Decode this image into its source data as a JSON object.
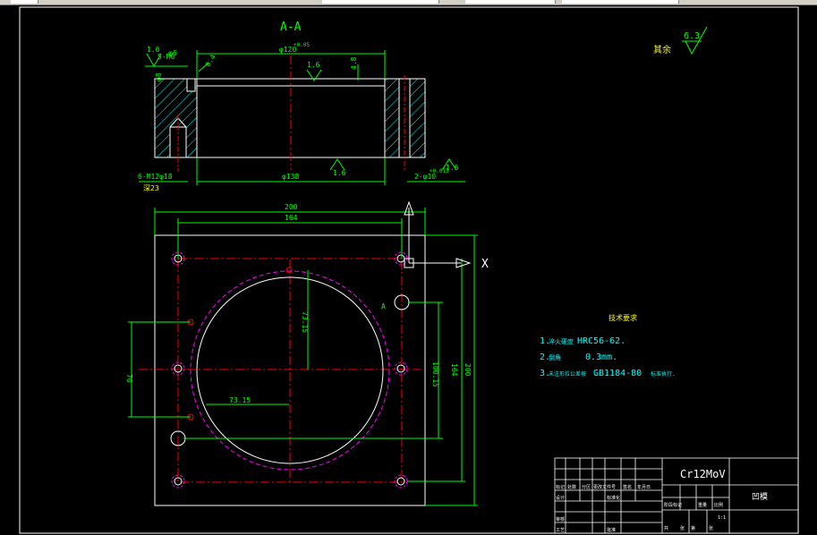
{
  "section_title": "A-A",
  "dimensions": {
    "d_top_a": "1.6",
    "d_top_b": "5-M6",
    "d_top_c": "φ6",
    "d_top_d": "φ8",
    "d_mid_top": "φ120",
    "d_mid_tol": "+0.05",
    "d_angle": "0.4",
    "d_rough_mid": "1.6",
    "d_depth": "4.8",
    "d_bot_left": "6-M12φ18",
    "d_bot_left2": "深23",
    "d_bot_center": "φ138",
    "d_rough_bot": "1.6",
    "d_bot_right": "2-φ10",
    "d_bot_right_tol": "+0.015",
    "d_rough_right": "1.6",
    "w_200": "200",
    "w_164": "164",
    "h_7315_a": "73.15",
    "h_7315_b": "73.15",
    "h_70": "70",
    "h_10015": "100.15",
    "h_164": "164",
    "h_200": "200",
    "label_a": "A",
    "label_a2": "A",
    "axis_x": "X"
  },
  "surface_finish": {
    "label": "其余",
    "value": "6.3"
  },
  "tech_requirements": {
    "title": "技术要求",
    "line1_prefix": "1.",
    "line1_cn": "淬火硬度",
    "line1_val": "HRC56-62.",
    "line2_prefix": "2.",
    "line2_cn": "倒角",
    "line2_val": "0.3mm.",
    "line3_prefix": "3.",
    "line3_cn": "未注形位公差按",
    "line3_val": "GB1184-80",
    "line3_suffix": "标准执行."
  },
  "title_block": {
    "material": "Cr12MoV",
    "drawing_name": "凹模",
    "cells": [
      "标记",
      "处数",
      "分区",
      "更改文件号",
      "签名",
      "年月日",
      "设计",
      "标准化",
      "审核",
      "工艺",
      "批准",
      "阶段标记",
      "重量",
      "比例",
      "共",
      "张",
      "第",
      "张",
      "1:1"
    ]
  },
  "colors": {
    "background": "#000000",
    "outline": "#ffffff",
    "dimension": "#00ff00",
    "center_line": "#ff0000",
    "hatch": "#00ffff",
    "hidden": "#ff00ff",
    "text_yellow": "#ffff00",
    "text_cyan": "#00ffff"
  }
}
